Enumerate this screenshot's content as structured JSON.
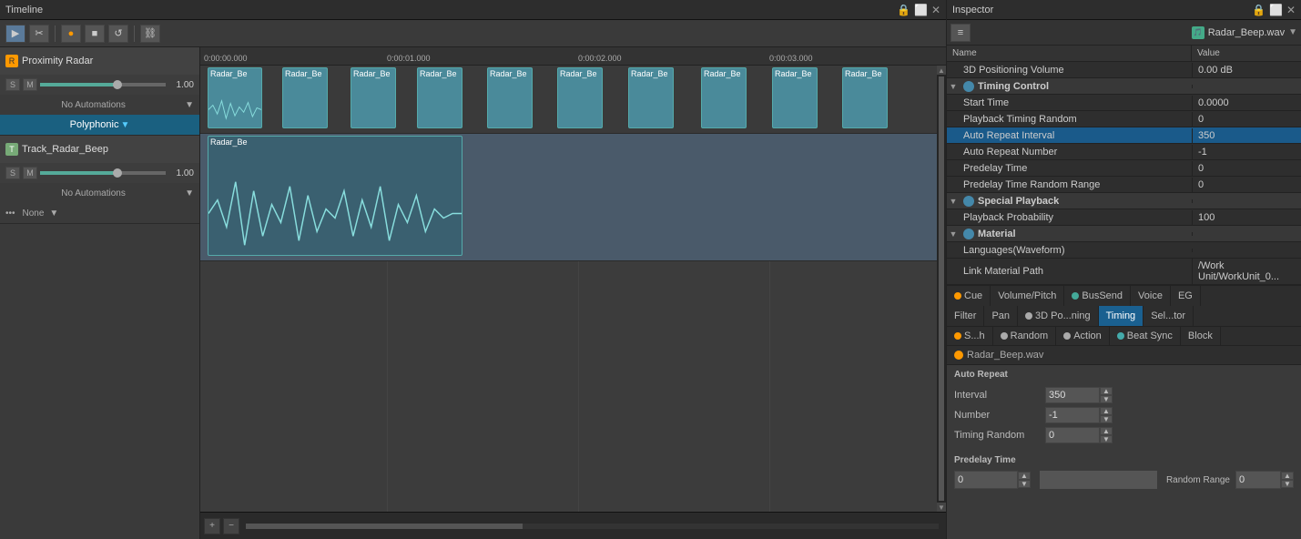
{
  "timeline": {
    "title": "Timeline",
    "toolbar": {
      "select_btn": "▶",
      "scissors_btn": "✂",
      "record_btn": "●",
      "stop_btn": "■",
      "loop_btn": "↺",
      "link_btn": "🔗"
    },
    "ruler": {
      "marks": [
        "0:00:00.000",
        "0:00:01.000",
        "0:00:02.000",
        "0:00:03.000"
      ]
    },
    "tracks": [
      {
        "name": "Proximity Radar",
        "type": "audio",
        "icon": "R",
        "volume": "1.00",
        "automation": "No Automations",
        "mode": "Polyphonic",
        "clips": [
          "Radar_Be",
          "Radar_Be",
          "Radar_Be",
          "Radar_Be",
          "Radar_Be",
          "Radar_Be",
          "Radar_Be",
          "Radar_Be",
          "Radar_Be",
          "Radar_Be"
        ]
      },
      {
        "name": "Track_Radar_Beep",
        "type": "track",
        "icon": "T",
        "volume": "1.00",
        "automation": "No Automations",
        "mode": "None",
        "clips": []
      }
    ]
  },
  "inspector": {
    "title": "Inspector",
    "file": "Radar_Beep.wav",
    "properties": {
      "headers": {
        "name": "Name",
        "value": "Value"
      },
      "rows": [
        {
          "name": "3D Positioning Volume",
          "value": "0.00 dB",
          "indent": true,
          "selected": false
        },
        {
          "name": "Timing Control",
          "value": "",
          "section": true,
          "indent": false
        },
        {
          "name": "Start Time",
          "value": "0.0000",
          "indent": true
        },
        {
          "name": "Playback Timing Random",
          "value": "0",
          "indent": true
        },
        {
          "name": "Auto Repeat Interval",
          "value": "350",
          "indent": true,
          "selected": true
        },
        {
          "name": "Auto Repeat Number",
          "value": "-1",
          "indent": true
        },
        {
          "name": "Predelay Time",
          "value": "0",
          "indent": true
        },
        {
          "name": "Predelay Time Random Range",
          "value": "0",
          "indent": true
        },
        {
          "name": "Special Playback",
          "value": "",
          "section": true
        },
        {
          "name": "Playback Probability",
          "value": "100",
          "indent": true
        },
        {
          "name": "Material",
          "value": "",
          "section": true
        },
        {
          "name": "Languages(Waveform)",
          "value": "",
          "indent": true
        },
        {
          "name": "Link Material Path",
          "value": "/Work Unit/WorkUnit_0...",
          "indent": true
        }
      ]
    },
    "tabs": {
      "row1": [
        {
          "label": "Cue",
          "dot": "orange",
          "active": false
        },
        {
          "label": "Volume/Pitch",
          "active": false
        },
        {
          "label": "BusSend",
          "dot": "green",
          "active": false
        },
        {
          "label": "Voice",
          "active": false
        },
        {
          "label": "EG",
          "active": false
        }
      ],
      "row2": [
        {
          "label": "Filter",
          "active": false
        },
        {
          "label": "Pan",
          "active": false
        },
        {
          "label": "3D Po...ning",
          "dot": "white",
          "active": false
        },
        {
          "label": "Timing",
          "active": true
        },
        {
          "label": "Sel...tor",
          "active": false
        }
      ]
    },
    "subtabs": [
      {
        "label": "S...h",
        "dot": "orange",
        "active": false
      },
      {
        "label": "Random",
        "dot": "white",
        "active": false
      },
      {
        "label": "Action",
        "dot": "white",
        "active": false
      },
      {
        "label": "Beat Sync",
        "dot": "teal",
        "active": false
      },
      {
        "label": "Block",
        "active": false
      }
    ],
    "section_file": "Radar_Beep.wav",
    "auto_repeat": {
      "label": "Auto Repeat",
      "interval_label": "Interval",
      "interval_value": "350",
      "number_label": "Number",
      "number_value": "-1",
      "timing_random_label": "Timing Random",
      "timing_random_value": "0"
    },
    "predelay": {
      "label": "Predelay Time",
      "value": "0",
      "random_range_label": "Random Range",
      "random_range_value": "0"
    }
  }
}
